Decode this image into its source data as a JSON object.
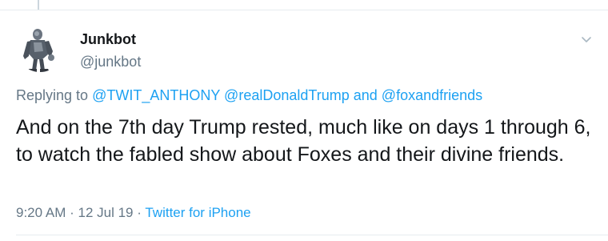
{
  "tweet": {
    "display_name": "Junkbot",
    "handle": "@junkbot",
    "replying_prefix": "Replying to",
    "reply_mentions": [
      "@TWIT_ANTHONY",
      "@realDonaldTrump"
    ],
    "reply_and": "and",
    "reply_last_mention": "@foxandfriends",
    "text": "And on the 7th day Trump rested, much like on days 1 through 6, to watch the fabled show about Foxes and their divine friends.",
    "time": "9:20 AM",
    "date": "12 Jul 19",
    "separator": "·",
    "source": "Twitter for iPhone"
  },
  "icons": {
    "avatar": "robot-avatar-icon",
    "menu": "chevron-down-icon"
  },
  "colors": {
    "link": "#1da1f2",
    "secondary_text": "#657786",
    "primary_text": "#14171a",
    "divider": "#e6ecf0"
  }
}
